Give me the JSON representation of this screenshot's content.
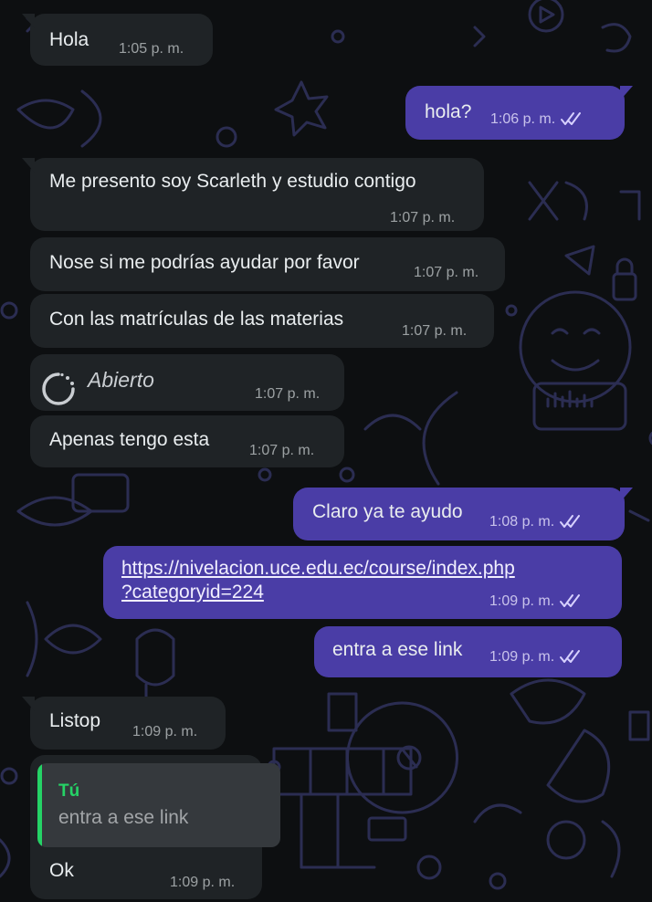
{
  "colors": {
    "background": "#0d0f11",
    "incoming_bubble": "#1f2326",
    "outgoing_bubble": "#4a3da6",
    "quote_accent": "#25d366"
  },
  "messages": [
    {
      "direction": "incoming",
      "text": "Hola",
      "time": "1:05 p. m."
    },
    {
      "direction": "outgoing",
      "text": "hola?",
      "time": "1:06 p. m.",
      "status_icon": "double-check-icon"
    },
    {
      "direction": "incoming",
      "text": "Me presento soy Scarleth  y estudio  contigo",
      "time": "1:07 p. m."
    },
    {
      "direction": "incoming",
      "text": "Nose si me podrías ayudar por favor",
      "time": "1:07 p. m."
    },
    {
      "direction": "incoming",
      "text": "Con las matrículas de las materias",
      "time": "1:07 p. m."
    },
    {
      "direction": "incoming",
      "text": "Abierto",
      "time": "1:07 p. m.",
      "icon": "view-once-icon"
    },
    {
      "direction": "incoming",
      "text": "Apenas tengo esta",
      "time": "1:07 p. m."
    },
    {
      "direction": "outgoing",
      "text": "Claro ya te ayudo",
      "time": "1:08 p. m.",
      "status_icon": "double-check-icon"
    },
    {
      "direction": "outgoing",
      "link_line1": "https://nivelacion.uce.edu.ec/course/index.php",
      "link_line2": "?categoryid=224",
      "time": "1:09 p. m.",
      "status_icon": "double-check-icon"
    },
    {
      "direction": "outgoing",
      "text": "entra a ese link",
      "time": "1:09 p. m.",
      "status_icon": "double-check-icon"
    },
    {
      "direction": "incoming",
      "text": "Listop",
      "time": "1:09 p. m."
    },
    {
      "direction": "incoming",
      "quote_author": "Tú",
      "quote_text": "entra a ese link",
      "text": "Ok",
      "time": "1:09 p. m."
    }
  ]
}
